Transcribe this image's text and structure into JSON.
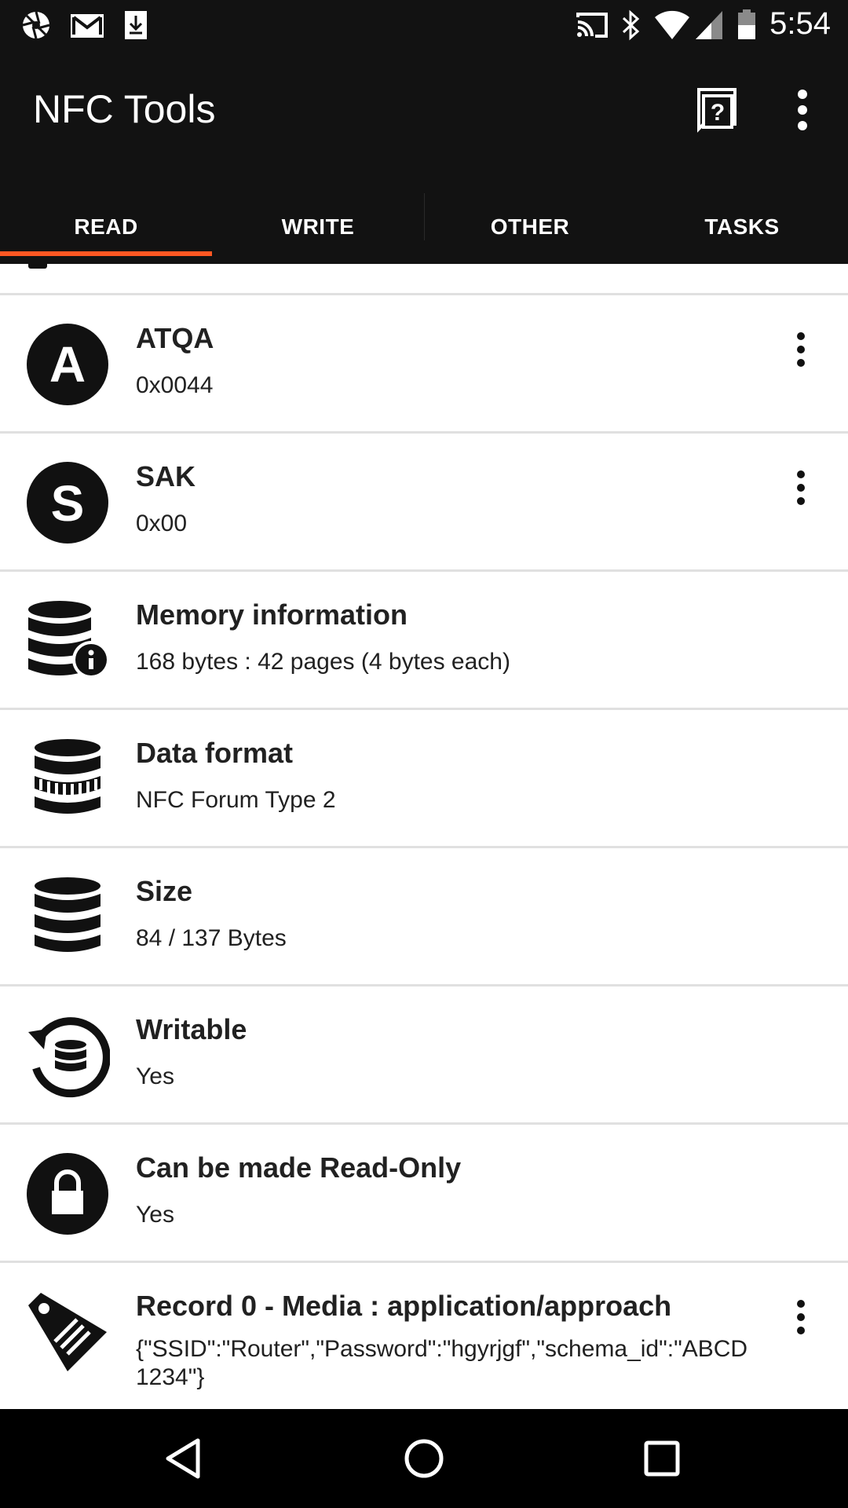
{
  "status_bar": {
    "time": "5:54",
    "left_icons": [
      "camera-aperture-icon",
      "gmail-icon",
      "download-icon"
    ],
    "right_icons": [
      "cast-icon",
      "bluetooth-icon",
      "wifi-icon",
      "signal-icon",
      "battery-icon"
    ]
  },
  "app_bar": {
    "title": "NFC Tools",
    "help_icon": "help-icon",
    "overflow_icon": "more-vert-icon"
  },
  "tabs": [
    {
      "label": "READ",
      "active": true
    },
    {
      "label": "WRITE",
      "active": false
    },
    {
      "label": "OTHER",
      "active": false
    },
    {
      "label": "TASKS",
      "active": false
    }
  ],
  "accent_color": "#ff5722",
  "rows": [
    {
      "icon": "letter-a-icon",
      "title": "ATQA",
      "value": "0x0044",
      "has_menu": true
    },
    {
      "icon": "letter-s-icon",
      "title": "SAK",
      "value": "0x00",
      "has_menu": true
    },
    {
      "icon": "database-info-icon",
      "title": "Memory information",
      "value": "168 bytes : 42 pages (4 bytes each)",
      "has_menu": false
    },
    {
      "icon": "database-format-icon",
      "title": "Data format",
      "value": "NFC Forum Type 2",
      "has_menu": false
    },
    {
      "icon": "database-icon",
      "title": "Size",
      "value": "84 / 137 Bytes",
      "has_menu": false
    },
    {
      "icon": "database-refresh-icon",
      "title": "Writable",
      "value": "Yes",
      "has_menu": false
    },
    {
      "icon": "lock-icon",
      "title": "Can be made Read-Only",
      "value": "Yes",
      "has_menu": false
    },
    {
      "icon": "tag-icon",
      "title": "Record 0 - Media : application/approach",
      "value": "{\"SSID\":\"Router\",\"Password\":\"hgyrjgf\",\"schema_id\":\"ABCD 1234\"}",
      "has_menu": true
    }
  ],
  "nav_bar": {
    "back_icon": "back-triangle-icon",
    "home_icon": "home-circle-icon",
    "recents_icon": "recents-square-icon"
  }
}
